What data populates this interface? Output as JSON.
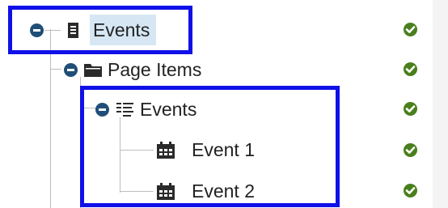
{
  "tree": {
    "root": {
      "label": "Events",
      "icon": "document-icon"
    },
    "page_items": {
      "label": "Page Items",
      "icon": "folder-icon"
    },
    "events_list": {
      "label": "Events",
      "icon": "list-icon"
    },
    "event_items": [
      {
        "label": "Event 1",
        "icon": "calendar-icon"
      },
      {
        "label": "Event 2",
        "icon": "calendar-icon"
      }
    ]
  },
  "status": {
    "icon": "check-circle-icon",
    "color": "#4a7f1d"
  },
  "highlight_color": "#1010e8"
}
